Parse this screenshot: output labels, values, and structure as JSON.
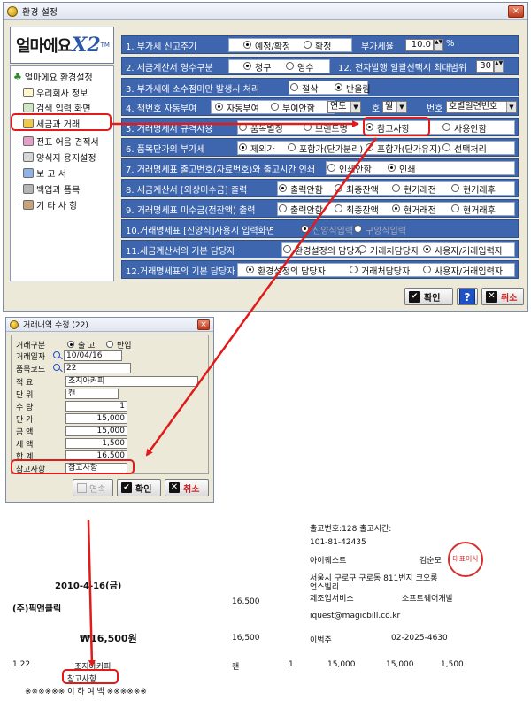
{
  "main": {
    "title": "환경 설정",
    "close_glyph": "×",
    "logo_text": "얼마에요",
    "logo_mark": "X2",
    "logo_tm": "TM",
    "tree": {
      "root": "얼마에요 환경설정",
      "items": [
        "우리회사 정보",
        "검색 입력 화면",
        "세금과 거래",
        "전표 어음 견적서",
        "양식지 용지설정",
        "보 고 서",
        "백업과 폼목",
        "기 타 사 항"
      ]
    },
    "rows": [
      {
        "label": "1. 부가세 신고주기",
        "options": [
          "예정/확정",
          "확정"
        ],
        "selected": 0,
        "extra_label": "부가세율",
        "extra_value": "10.0",
        "extra_unit": "%"
      },
      {
        "label": "2. 세금계산서 영수구분",
        "options": [
          "청구",
          "영수"
        ],
        "selected": 0,
        "extra_label": "12. 전자발행 일괄선택시 최대범위",
        "extra_value": "30"
      },
      {
        "label": "3. 부가세에 소수점미만 발생시 처리",
        "options": [
          "절삭",
          "반올림"
        ],
        "selected": 1
      },
      {
        "label": "4. 책번호 자동부여",
        "options": [
          "자동부여",
          "부여안함"
        ],
        "selected": 0,
        "sel1_label": "책",
        "sel1_value": "연도",
        "sel2_label": "호",
        "sel2_value": "월",
        "sel3_label": "번호",
        "sel3_value": "호별일련번호"
      },
      {
        "label": "5. 거래명세서 규격사용",
        "options": [
          "품목별칭",
          "브랜드명",
          "참고사항",
          "사용안함"
        ],
        "selected": 2
      },
      {
        "label": "6. 품목단가의 부가세",
        "options": [
          "제외가",
          "포함가(단가분리)",
          "포함가(단가유지)",
          "선택처리"
        ],
        "selected": 0
      },
      {
        "label": "7. 거래명세표 출고번호(자료번호)와 출고시간 인쇄",
        "options": [
          "인쇄안함",
          "인쇄"
        ],
        "selected": 1
      },
      {
        "label": "8. 세금계산서 [외상미수금] 출력",
        "options": [
          "출력안함",
          "최종잔액",
          "현거래전",
          "현거래후"
        ],
        "selected": 0
      },
      {
        "label": "9. 거래명세표 미수금(전잔액) 출력",
        "options": [
          "출력안함",
          "최종잔액",
          "현거래전",
          "현거래후"
        ],
        "selected": 2
      },
      {
        "label": "10.거래명세표 [신양식]사용시 입력화면",
        "options": [
          "신양식입력",
          "구양식입력"
        ],
        "selected": 0,
        "disabled": true
      },
      {
        "label": "11.세금계산서의 기본 담당자",
        "options": [
          "환경설정의 담당자",
          "거래처담당자",
          "사용자/거래입력자"
        ],
        "selected": 2
      },
      {
        "label": "12.거래명세표의 기본 담당자",
        "options": [
          "환경설정의 담당자",
          "거래처담당자",
          "사용자/거래입력자"
        ],
        "selected": 0
      }
    ],
    "ok_label": "확인",
    "help_label": "?",
    "cancel_label": "취소"
  },
  "edit": {
    "title": "거래내역 수정",
    "title_count": "(22)",
    "type_label": "거래구분",
    "type_options": [
      "출 고",
      "반입"
    ],
    "type_selected": 0,
    "fields": [
      {
        "label": "거래일자",
        "value": "10/04/16"
      },
      {
        "label": "품목코드",
        "value": "22"
      },
      {
        "label": "적   요",
        "value": "조지아커피"
      },
      {
        "label": "단   위",
        "value": "캔"
      },
      {
        "label": "수   량",
        "value": "1"
      },
      {
        "label": "단   가",
        "value": "15,000"
      },
      {
        "label": "금   액",
        "value": "15,000"
      },
      {
        "label": "세   액",
        "value": "1,500"
      },
      {
        "label": "합   계",
        "value": "16,500"
      },
      {
        "label": "참고사항",
        "value": "참고사항"
      }
    ],
    "link_label": "연속",
    "ok_label": "확인",
    "cancel_label": "취소"
  },
  "invoice": {
    "header_line": "출고번호:128  출고시간:",
    "biz_no": "101-81-42435",
    "company": "아이퀘스트",
    "rep": "김순모",
    "address": "서울시 구로구 구로동 811번지 코오롱",
    "address2": "언스빌리",
    "business": "제조업서비스",
    "item_type": "소프트웨어개발",
    "email": "iquest@magicbill.co.kr",
    "manager": "이범주",
    "phone": "02-2025-4630",
    "date": "2010-4-16(금)",
    "customer": "(주)픽앤클릭",
    "amount_small": "16,500",
    "total_won": "₩16,500원",
    "amount_small2": "16,500",
    "line": {
      "no": "1 22",
      "name": "조지아커피",
      "unit": "캔",
      "qty": "1",
      "price": "15,000",
      "supply": "15,000",
      "tax": "1,500"
    },
    "note": "참고사항",
    "end_mark": "※※※※※※ 이 하 여 백 ※※※※※※",
    "seal_text": "대표이사"
  }
}
